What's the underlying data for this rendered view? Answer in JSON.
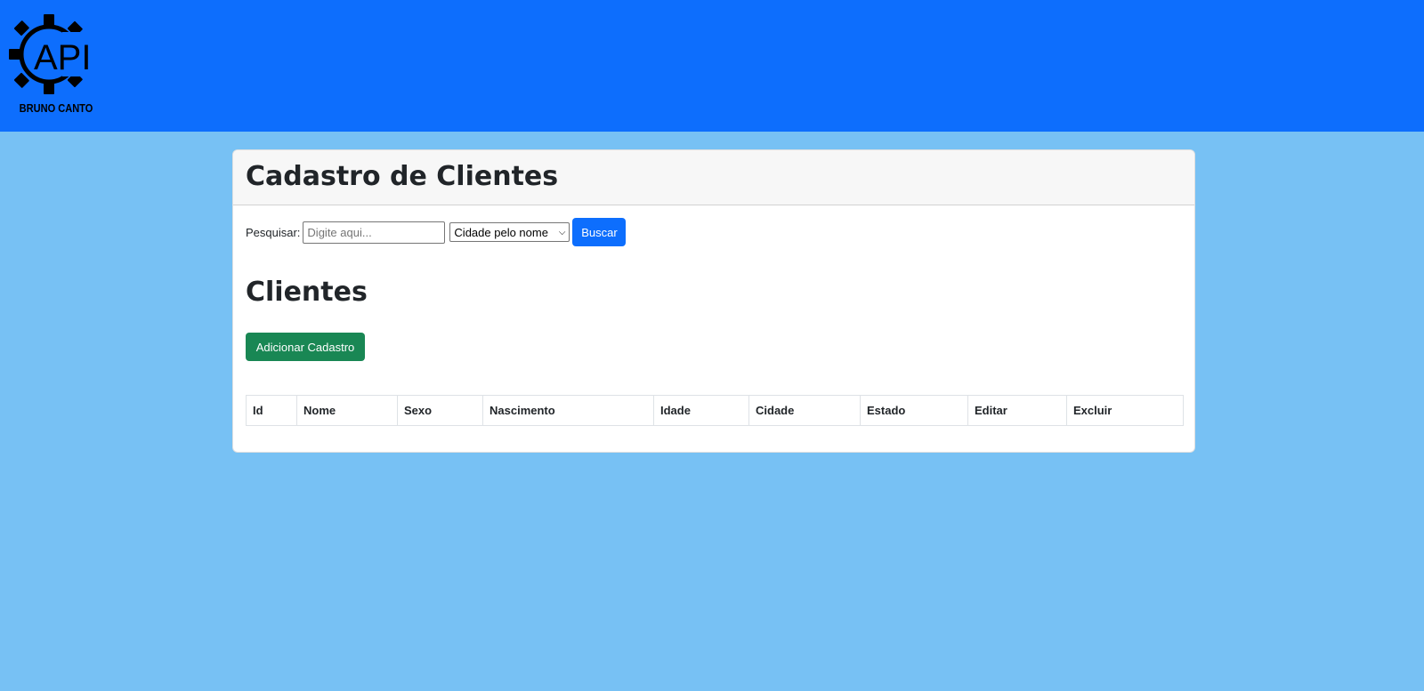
{
  "header": {
    "logo_text": "API",
    "logo_caption": "BRUNO CANTO"
  },
  "card": {
    "title": "Cadastro de Clientes"
  },
  "search": {
    "label": "Pesquisar:",
    "placeholder": "Digite aqui...",
    "value": "",
    "filter_selected": "Cidade pelo nome",
    "button_label": "Buscar"
  },
  "clients": {
    "title": "Clientes",
    "add_button_label": "Adicionar Cadastro",
    "columns": [
      "Id",
      "Nome",
      "Sexo",
      "Nascimento",
      "Idade",
      "Cidade",
      "Estado",
      "Editar",
      "Excluir"
    ],
    "rows": []
  },
  "colors": {
    "topbar": "#0d6efd",
    "background": "#77c1f4",
    "primary": "#0d6efd",
    "success": "#198754"
  }
}
